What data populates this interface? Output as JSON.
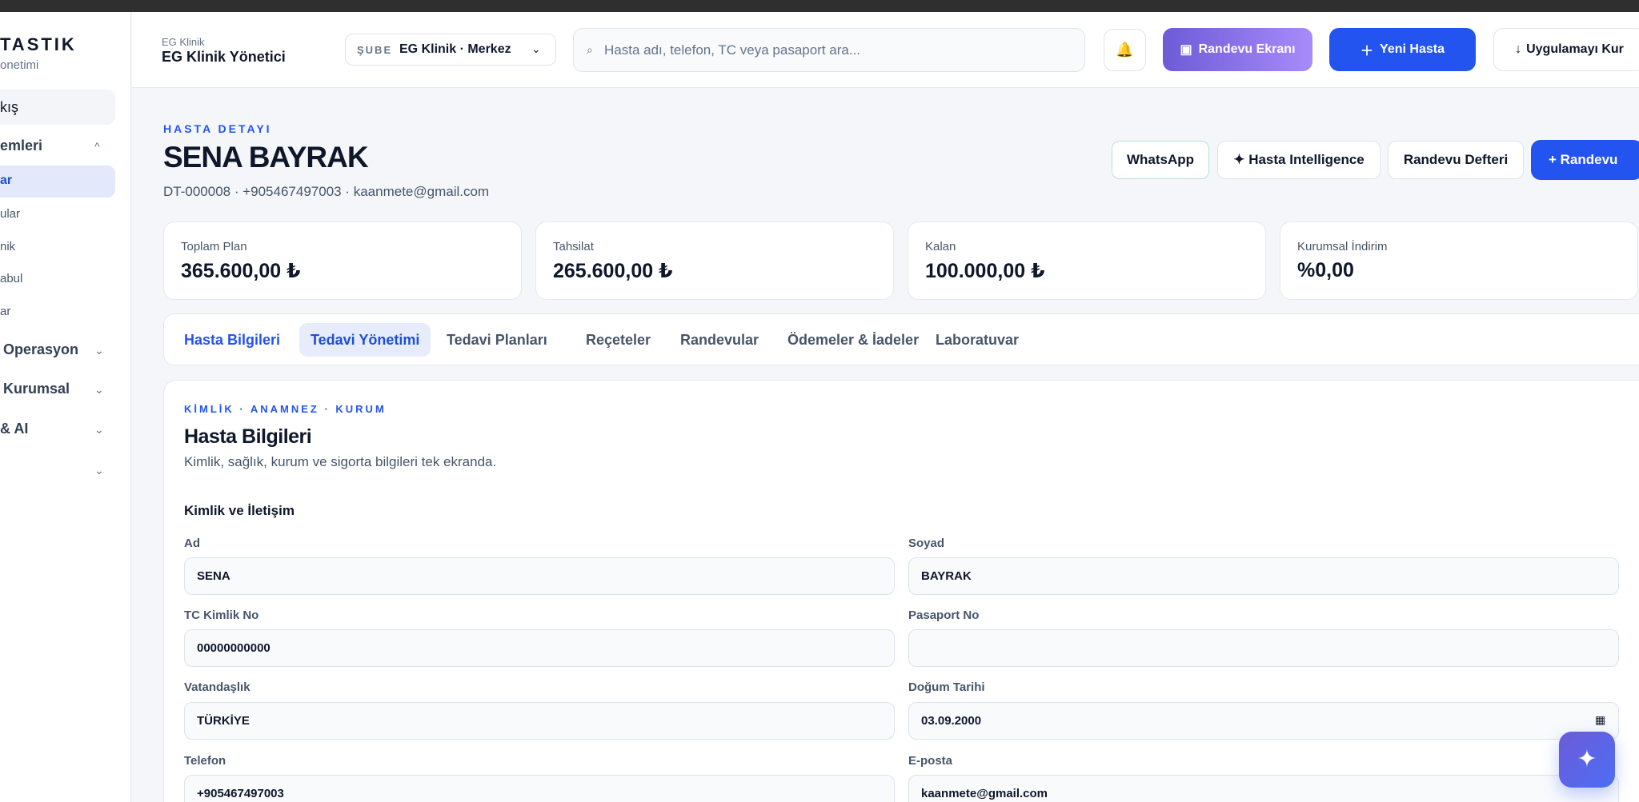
{
  "sidebar": {
    "brand": "TASTIK",
    "brand_sub": "onetimi",
    "top_item": "kış",
    "groups": [
      {
        "label": "emleri",
        "chevron": "^"
      },
      {
        "label": "Operasyon",
        "chevron": "⌄"
      },
      {
        "label": "Kurumsal",
        "chevron": "⌄"
      },
      {
        "label": "& AI",
        "chevron": "⌄"
      },
      {
        "label": "",
        "chevron": "⌄"
      }
    ],
    "active_item": "ar",
    "sub_items": [
      "ular",
      "nik",
      "abul",
      "ar"
    ]
  },
  "header": {
    "org_small": "EG Klinik",
    "org_big": "EG Klinik Yönetici",
    "branch_label": "ŞUBE",
    "branch_value": "EG Klinik · Merkez",
    "search_placeholder": "Hasta adı, telefon, TC veya pasaport ara...",
    "randevu_ekrani": "Randevu Ekranı",
    "yeni_hasta": "Yeni Hasta",
    "uygulamayi_kur": "Uygulamayı Kur"
  },
  "patient": {
    "eyebrow": "HASTA DETAYI",
    "name": "SENA BAYRAK",
    "meta": "DT-000008 · +905467497003 · kaanmete@gmail.com",
    "actions": {
      "whatsapp": "WhatsApp",
      "intelligence": "✦ Hasta Intelligence",
      "defter": "Randevu Defteri",
      "randevu": "+ Randevu"
    }
  },
  "stats": [
    {
      "label": "Toplam Plan",
      "value": "365.600,00 ₺"
    },
    {
      "label": "Tahsilat",
      "value": "265.600,00 ₺"
    },
    {
      "label": "Kalan",
      "value": "100.000,00 ₺"
    },
    {
      "label": "Kurumsal İndirim",
      "value": "%0,00"
    }
  ],
  "tabs": [
    "Hasta Bilgileri",
    "Tedavi Yönetimi",
    "Tedavi Planları",
    "Reçeteler",
    "Randevular",
    "Ödemeler & İadeler",
    "Laboratuvar"
  ],
  "card": {
    "eyebrow": "KİMLİK · ANAMNEZ · KURUM",
    "title": "Hasta Bilgileri",
    "desc": "Kimlik, sağlık, kurum ve sigorta bilgileri tek ekranda.",
    "section": "Kimlik ve İletişim",
    "fields": {
      "ad": {
        "label": "Ad",
        "value": "SENA"
      },
      "soyad": {
        "label": "Soyad",
        "value": "BAYRAK"
      },
      "tc": {
        "label": "TC Kimlik No",
        "value": "00000000000"
      },
      "pasaport": {
        "label": "Pasaport No",
        "value": ""
      },
      "vatandaslik": {
        "label": "Vatandaşlık",
        "value": "TÜRKİYE"
      },
      "dogum": {
        "label": "Doğum Tarihi",
        "value": "03.09.2000"
      },
      "telefon": {
        "label": "Telefon",
        "value": "+905467497003"
      },
      "eposta": {
        "label": "E-posta",
        "value": "kaanmete@gmail.com"
      }
    }
  },
  "colors": {
    "accent": "#2354f0",
    "purple": "#8b7cf0",
    "whatsapp_border": "#b7e4cd"
  }
}
